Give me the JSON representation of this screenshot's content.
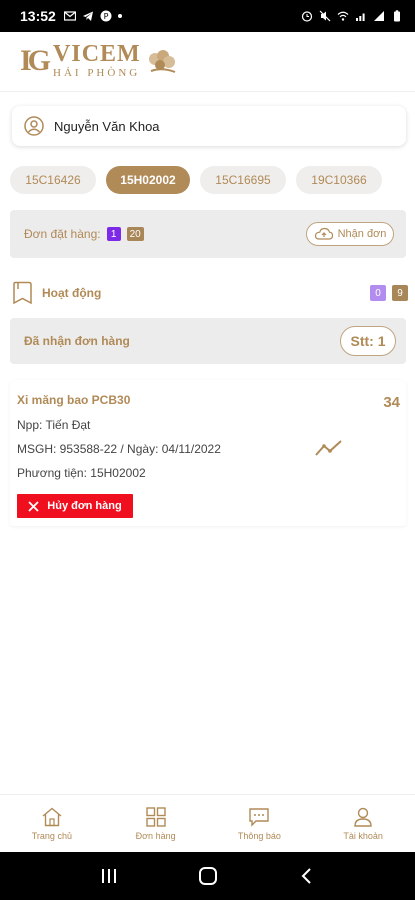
{
  "statusbar": {
    "time": "13:52"
  },
  "header": {
    "logo_mark": "IG",
    "brand": "VICEM",
    "brand_sub": "HẢI PHÒNG"
  },
  "user": {
    "name": "Nguyễn Văn Khoa"
  },
  "plates": [
    {
      "label": "15C16426",
      "active": false
    },
    {
      "label": "15H02002",
      "active": true
    },
    {
      "label": "15C16695",
      "active": false
    },
    {
      "label": "19C10366",
      "active": false
    }
  ],
  "orders": {
    "label": "Đơn đặt hàng:",
    "badge_a": "1",
    "badge_b": "20",
    "receive_label": "Nhận đơn"
  },
  "activity": {
    "label": "Hoạt động",
    "badge_a": "0",
    "badge_b": "9"
  },
  "received": {
    "label": "Đã nhận đơn hàng",
    "stt": "Stt: 1"
  },
  "order": {
    "product": "Xi măng bao PCB30",
    "qty": "34",
    "npp": "Npp: Tiến Đạt",
    "msgh": "MSGH: 953588-22 / Ngày: 04/11/2022",
    "vehicle": "Phương tiện: 15H02002",
    "cancel_label": "Hủy đơn hàng"
  },
  "nav": [
    {
      "label": "Trang chủ",
      "icon": "home-icon"
    },
    {
      "label": "Đơn hàng",
      "icon": "grid-icon"
    },
    {
      "label": "Thông báo",
      "icon": "message-icon"
    },
    {
      "label": "Tài khoản",
      "icon": "person-icon"
    }
  ],
  "colors": {
    "accent": "#b08a57",
    "danger": "#f00f1e",
    "badge_purple": "#7c2ae8",
    "badge_tan": "#a88657"
  }
}
